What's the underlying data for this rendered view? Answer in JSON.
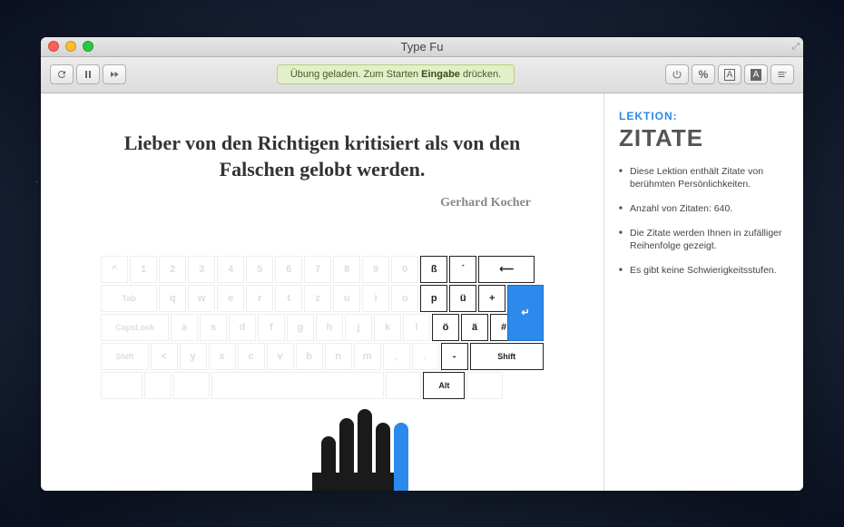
{
  "window": {
    "title": "Type Fu"
  },
  "status": {
    "prefix": "Übung geladen. Zum Starten ",
    "bold": "Eingabe",
    "suffix": " drücken."
  },
  "quote": {
    "text": "Lieber von den Richtigen kritisiert als von den Falschen gelobt werden.",
    "author": "Gerhard Kocher"
  },
  "sidebar": {
    "label": "LEKTION:",
    "title": "ZITATE",
    "bullets": [
      "Diese Lektion enthält Zitate von berühmten Persönlichkeiten.",
      "Anzahl von Zitaten: 640.",
      "Die Zitate werden Ihnen in zufälliger Reihenfolge gezeigt.",
      "Es gibt keine Schwierigkeitsstufen."
    ]
  },
  "keyboard": {
    "rows": [
      [
        {
          "l": "^",
          "w": 1,
          "a": false
        },
        {
          "l": "1",
          "w": 1,
          "a": false
        },
        {
          "l": "2",
          "w": 1,
          "a": false
        },
        {
          "l": "3",
          "w": 1,
          "a": false
        },
        {
          "l": "4",
          "w": 1,
          "a": false
        },
        {
          "l": "5",
          "w": 1,
          "a": false
        },
        {
          "l": "6",
          "w": 1,
          "a": false
        },
        {
          "l": "7",
          "w": 1,
          "a": false
        },
        {
          "l": "8",
          "w": 1,
          "a": false
        },
        {
          "l": "9",
          "w": 1,
          "a": false
        },
        {
          "l": "0",
          "w": 1,
          "a": false
        },
        {
          "l": "ß",
          "w": 1,
          "a": true
        },
        {
          "l": "´",
          "w": 1,
          "a": true
        },
        {
          "l": "⟵",
          "w": 2,
          "a": true
        }
      ],
      [
        {
          "l": "Tab",
          "w": 2,
          "a": false
        },
        {
          "l": "q",
          "w": 1,
          "a": false
        },
        {
          "l": "w",
          "w": 1,
          "a": false
        },
        {
          "l": "e",
          "w": 1,
          "a": false
        },
        {
          "l": "r",
          "w": 1,
          "a": false
        },
        {
          "l": "t",
          "w": 1,
          "a": false
        },
        {
          "l": "z",
          "w": 1,
          "a": false
        },
        {
          "l": "u",
          "w": 1,
          "a": false
        },
        {
          "l": "i",
          "w": 1,
          "a": false
        },
        {
          "l": "o",
          "w": 1,
          "a": false
        },
        {
          "l": "p",
          "w": 1,
          "a": true
        },
        {
          "l": "ü",
          "w": 1,
          "a": true
        },
        {
          "l": "+",
          "w": 1,
          "a": true
        },
        {
          "l": "↵",
          "w": 1.3,
          "a": true,
          "hl": true
        }
      ],
      [
        {
          "l": "CapsLock",
          "w": 2.4,
          "a": false
        },
        {
          "l": "a",
          "w": 1,
          "a": false
        },
        {
          "l": "s",
          "w": 1,
          "a": false
        },
        {
          "l": "d",
          "w": 1,
          "a": false
        },
        {
          "l": "f",
          "w": 1,
          "a": false
        },
        {
          "l": "g",
          "w": 1,
          "a": false
        },
        {
          "l": "h",
          "w": 1,
          "a": false
        },
        {
          "l": "j",
          "w": 1,
          "a": false
        },
        {
          "l": "k",
          "w": 1,
          "a": false
        },
        {
          "l": "l",
          "w": 1,
          "a": false
        },
        {
          "l": "ö",
          "w": 1,
          "a": true
        },
        {
          "l": "ä",
          "w": 1,
          "a": true
        },
        {
          "l": "#",
          "w": 1,
          "a": true
        }
      ],
      [
        {
          "l": "Shift",
          "w": 1.7,
          "a": false
        },
        {
          "l": "<",
          "w": 1,
          "a": false
        },
        {
          "l": "y",
          "w": 1,
          "a": false
        },
        {
          "l": "x",
          "w": 1,
          "a": false
        },
        {
          "l": "c",
          "w": 1,
          "a": false
        },
        {
          "l": "v",
          "w": 1,
          "a": false
        },
        {
          "l": "b",
          "w": 1,
          "a": false
        },
        {
          "l": "n",
          "w": 1,
          "a": false
        },
        {
          "l": "m",
          "w": 1,
          "a": false
        },
        {
          "l": ",",
          "w": 1,
          "a": false
        },
        {
          "l": ".",
          "w": 1,
          "a": false
        },
        {
          "l": "-",
          "w": 1,
          "a": true
        },
        {
          "l": "Shift",
          "w": 2.6,
          "a": true
        }
      ],
      [
        {
          "l": "",
          "w": 1.5,
          "a": false
        },
        {
          "l": "",
          "w": 1,
          "a": false
        },
        {
          "l": "",
          "w": 1.3,
          "a": false
        },
        {
          "l": "",
          "w": 6,
          "a": false
        },
        {
          "l": "",
          "w": 1.3,
          "a": false
        },
        {
          "l": "Alt",
          "w": 1.5,
          "a": true
        },
        {
          "l": "",
          "w": 1.3,
          "a": false
        }
      ]
    ]
  },
  "icons": {
    "refresh": "refresh-icon",
    "pause": "pause-icon",
    "forward": "forward-icon",
    "power": "power-icon",
    "percent": "percent-icon",
    "boxA1": "a-outline-icon",
    "boxA2": "a-filled-icon",
    "menu": "menu-icon"
  }
}
